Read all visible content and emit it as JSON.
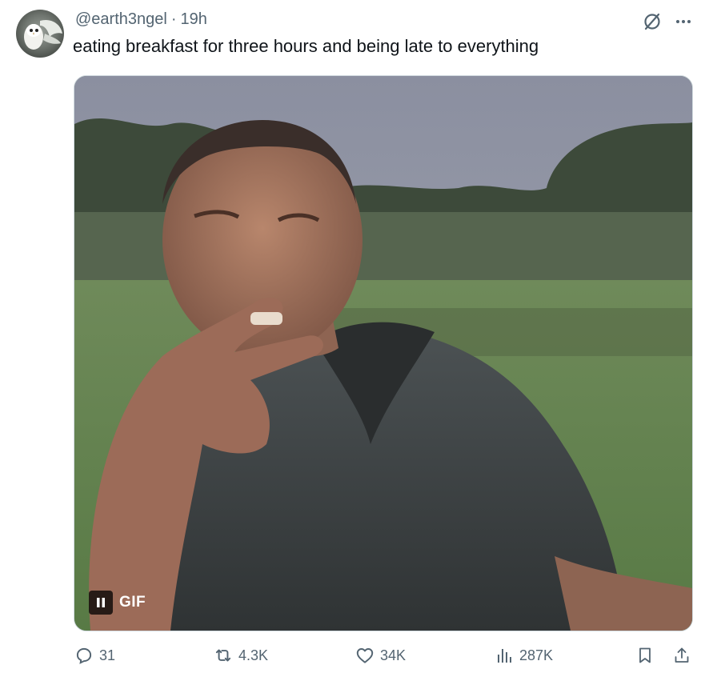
{
  "tweet": {
    "handle": "@earth3ngel",
    "separator": "·",
    "time": "19h",
    "text": "eating breakfast for three hours and being late to everything"
  },
  "media": {
    "badge_label": "GIF",
    "playing": true
  },
  "actions": {
    "replies": "31",
    "reposts": "4.3K",
    "likes": "34K",
    "views": "287K"
  },
  "icons": {
    "top_right": [
      "grok-slash-icon",
      "more-dots-icon"
    ],
    "actions": [
      "reply-icon",
      "repost-icon",
      "like-icon",
      "views-icon",
      "bookmark-icon",
      "share-icon"
    ]
  },
  "colors": {
    "text_primary": "#0f1419",
    "text_secondary": "#536471",
    "border": "#cfd9de"
  }
}
